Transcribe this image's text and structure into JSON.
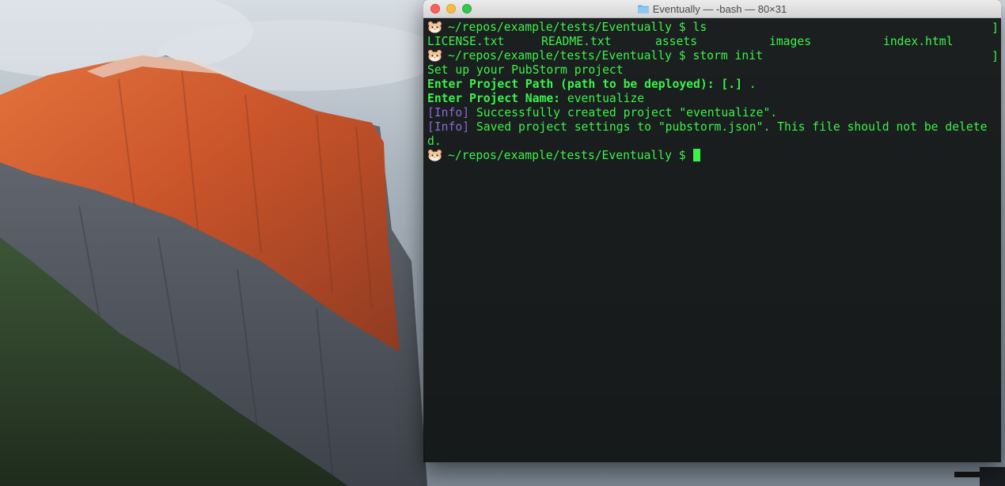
{
  "window": {
    "title": "Eventually — -bash — 80×31"
  },
  "terminal": {
    "prompt_path": "~/repos/example/tests/Eventually $",
    "lines": [
      {
        "kind": "prompt",
        "command": "ls"
      },
      {
        "kind": "ls",
        "items": [
          "LICENSE.txt",
          "README.txt",
          "assets",
          "images",
          "index.html"
        ]
      },
      {
        "kind": "prompt",
        "command": "storm init"
      },
      {
        "kind": "plain",
        "text": "Set up your PubStorm project"
      },
      {
        "kind": "qa",
        "label": "Enter Project Path (path to be deployed): [.]",
        "value": " ."
      },
      {
        "kind": "qa",
        "label": "Enter Project Name:",
        "value": " eventualize"
      },
      {
        "kind": "info",
        "tag": "[Info]",
        "text": " Successfully created project \"eventualize\"."
      },
      {
        "kind": "info",
        "tag": "[Info]",
        "text": " Saved project settings to \"pubstorm.json\". This file should not be delete"
      },
      {
        "kind": "plain",
        "text": "d."
      },
      {
        "kind": "prompt",
        "command": ""
      }
    ],
    "colors": {
      "text": "#3bf24a",
      "info": "#8a6bd6",
      "background": "#0e1111"
    },
    "prompt_icon": "hamster-icon"
  }
}
